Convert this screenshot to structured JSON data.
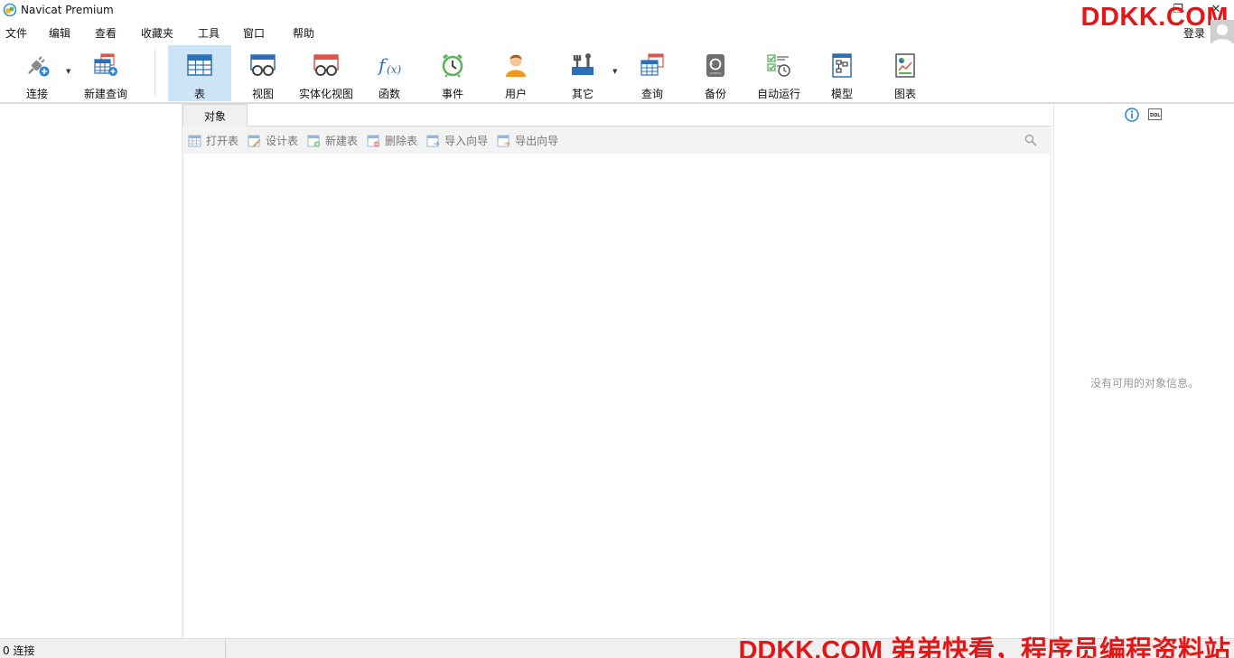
{
  "titlebar": {
    "title": "Navicat Premium"
  },
  "watermark": {
    "top": "DDKK.COM",
    "bottom": "DDKK.COM 弟弟快看，程序员编程资料站"
  },
  "menu": [
    "文件",
    "编辑",
    "查看",
    "收藏夹",
    "工具",
    "窗口",
    "帮助"
  ],
  "account": {
    "login": "登录"
  },
  "toolbar": {
    "connect": "连接",
    "new_query": "新建查询",
    "table": "表",
    "view": "视图",
    "materialized_view": "实体化视图",
    "function": "函数",
    "event": "事件",
    "user": "用户",
    "other": "其它",
    "query": "查询",
    "backup": "备份",
    "automation": "自动运行",
    "model": "模型",
    "chart": "图表",
    "active": "表"
  },
  "tabs": {
    "objects": "对象"
  },
  "object_toolbar": {
    "open_table": "打开表",
    "design_table": "设计表",
    "new_table": "新建表",
    "delete_table": "删除表",
    "import_wizard": "导入向导",
    "export_wizard": "导出向导"
  },
  "info_panel": {
    "empty": "没有可用的对象信息。"
  },
  "status": {
    "connections": "0 连接"
  },
  "colors": {
    "accent": "#cde4f7",
    "watermark": "#e21818",
    "table_blue": "#2d6fb7",
    "table_red": "#d9574b"
  }
}
